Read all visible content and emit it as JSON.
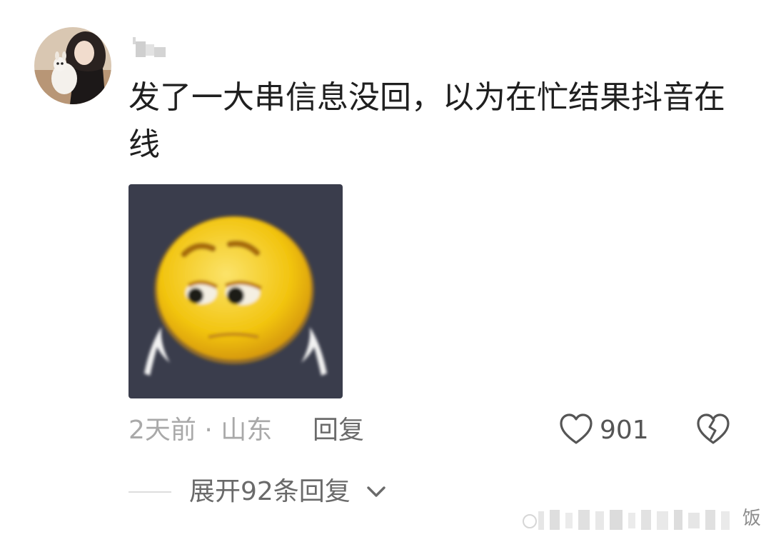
{
  "comment": {
    "text": "发了一大串信息没回，以为在忙结果抖音在线",
    "sticker": "worried-face-emoji-sticker",
    "time_location": "2天前 · 山东",
    "reply_label": "回复",
    "like_count": "901",
    "like_icon": "heart-outline-icon",
    "dislike_icon": "broken-heart-icon",
    "expand_replies": "展开92条回复",
    "expand_icon": "chevron-down-icon"
  },
  "colors": {
    "background": "#ffffff",
    "text_primary": "#1f1f1f",
    "text_meta": "#a9a9a9",
    "text_action": "#6b6b6b",
    "sticker_bg": "#3a3d4c",
    "emoji_yellow": "#f2c40f"
  },
  "watermark": {
    "text": "饭"
  }
}
